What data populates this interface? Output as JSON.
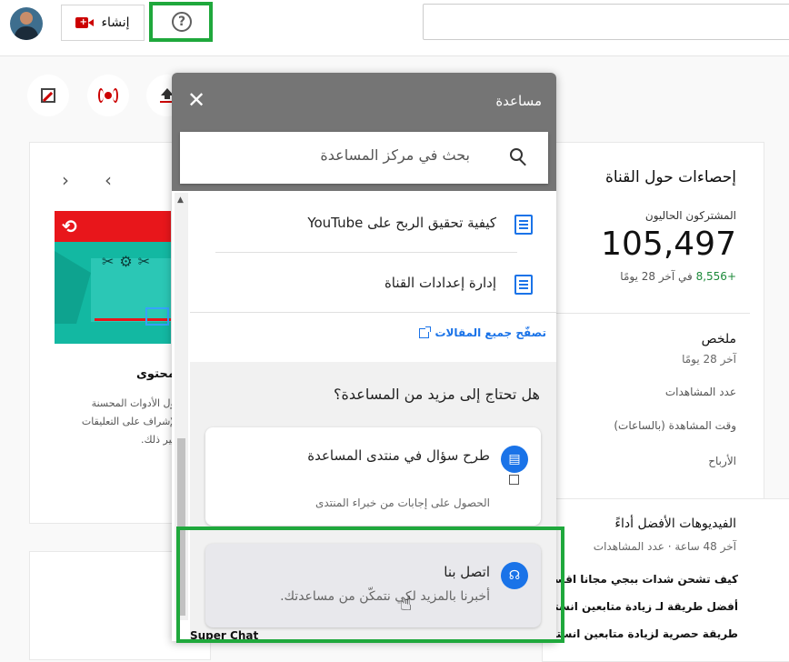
{
  "header": {
    "create_label": "إنشاء",
    "help_icon_glyph": "?"
  },
  "analytics": {
    "title": "إحصاءات حول القناة",
    "subscribers_label": "المشتركون الحاليون",
    "subscribers_value": "105,497",
    "subscribers_delta": "+8,556",
    "subscribers_period": "في آخر 28 يومًا",
    "summary_title": "ملخص",
    "summary_period": "آخر 28 يومًا",
    "metrics": [
      "عدد المشاهدات",
      "وقت المشاهدة (بالساعات)",
      "الأرباح"
    ],
    "top_videos_title": "الفيديوهات الأفضل أداءً",
    "top_videos_sub": "آخر 48 ساعة · عدد المشاهدات",
    "videos": [
      "كيف تشحن شدات ببجي مجانا اقسم بالله",
      "أفضل طريقة لـ زيادة متابعين انستقرام",
      "طريقة حصرية لزيادة متابعين انستقرام"
    ]
  },
  "ideas": {
    "title": "محتوى",
    "text": "حول الأدوات المحسنة بالإشراف على التعليقات وغير ذلك."
  },
  "help_panel": {
    "title": "مساعدة",
    "search_placeholder": "بحث في مركز المساعدة",
    "articles": [
      "كيفية تحقيق الربح على YouTube",
      "إدارة إعدادات القناة"
    ],
    "browse_all": "تصفّح جميع المقالات",
    "need_more": "هل تحتاج إلى مزيد من المساعدة؟",
    "community": {
      "title": "طرح سؤال في منتدى المساعدة",
      "subtitle": "الحصول على إجابات من خبراء المنتدى"
    },
    "contact": {
      "title": "اتصل بنا",
      "subtitle": "أخبرنا بالمزيد لكي نتمكّن من مساعدتك."
    },
    "bottom_fragment": "Super Chat"
  },
  "colors": {
    "highlight": "#1fa83c",
    "accent": "#1a73e8",
    "brand_red": "#cc0000"
  }
}
